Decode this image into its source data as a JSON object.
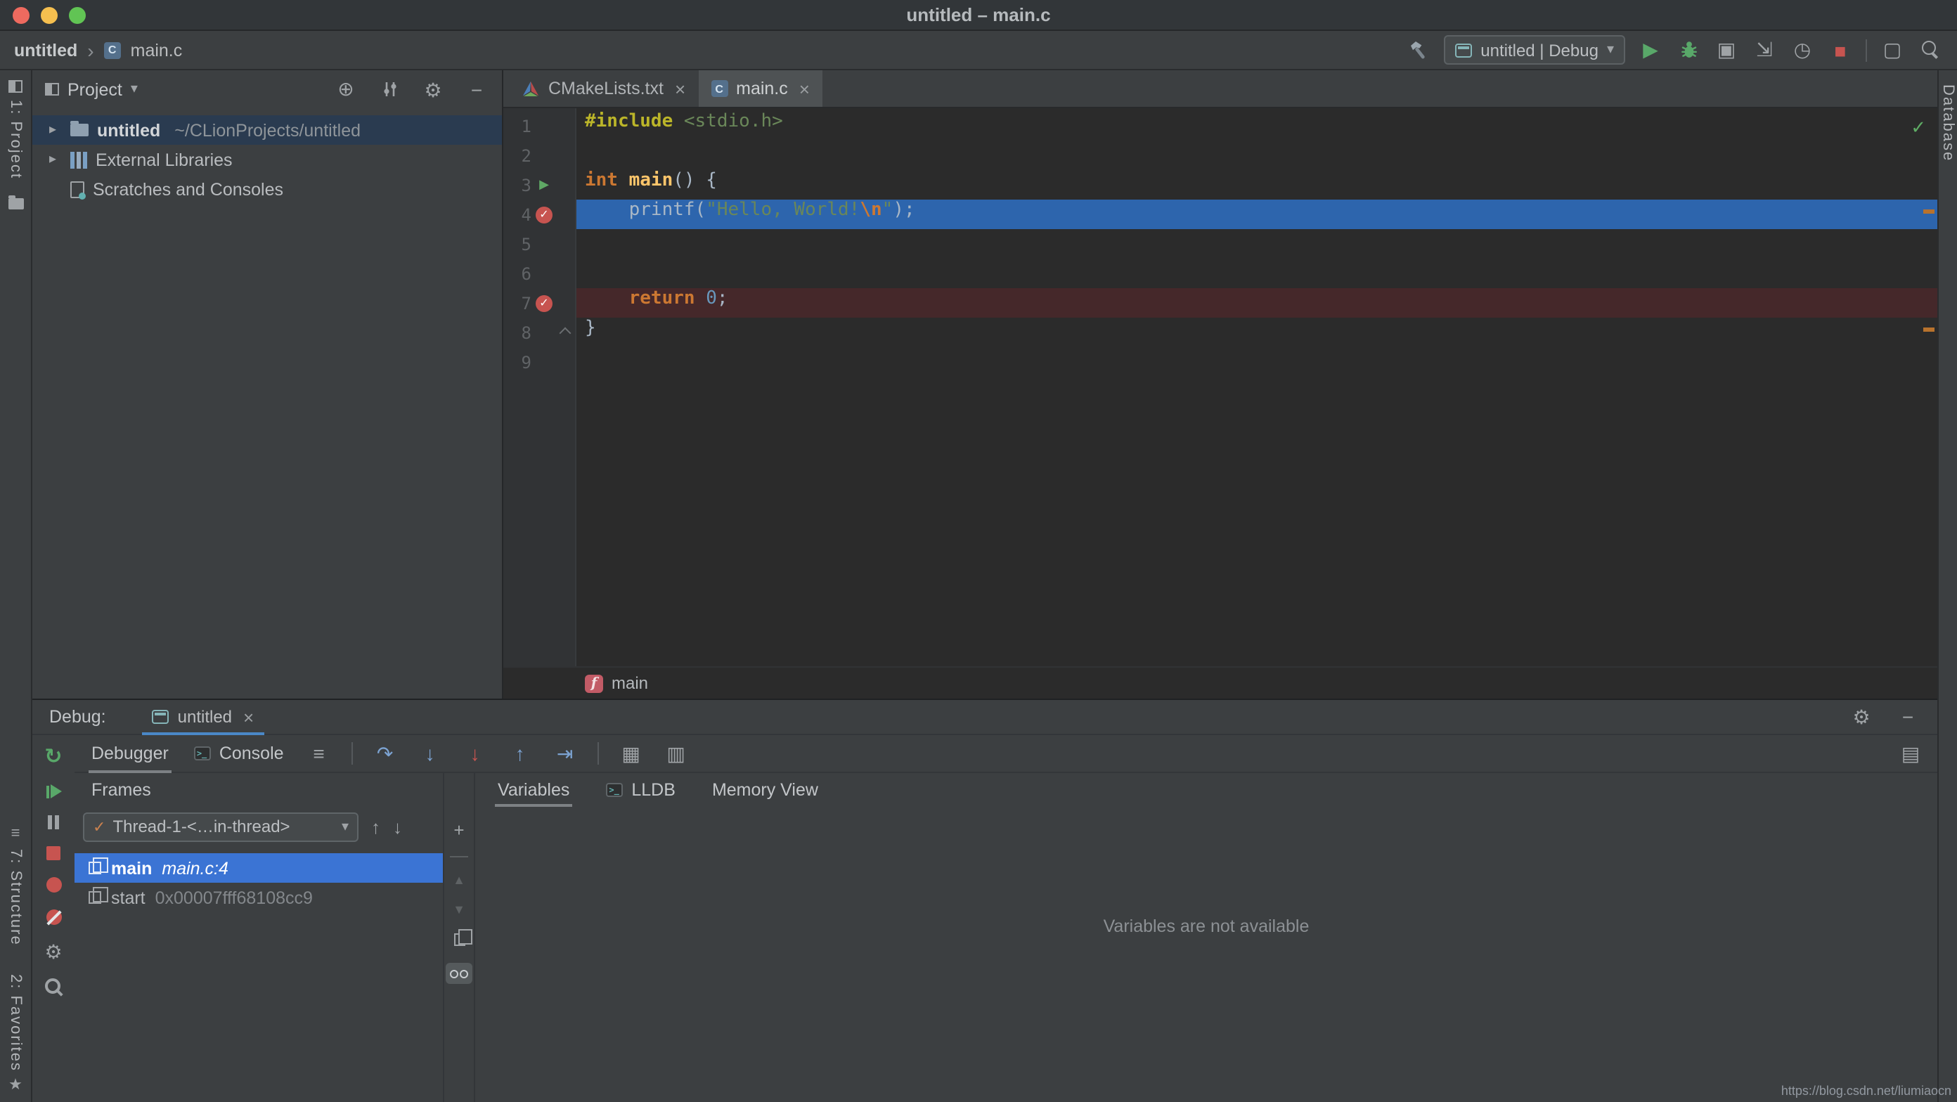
{
  "colors": {
    "execution_line_blue": "#2d65ad",
    "breakpoint_line_red": "#45282a",
    "breakpoint_red": "#c75450",
    "run_green": "#59a869",
    "frame_selection_blue": "#3b74d4",
    "tree_selection_blue": "#2a3b50",
    "session_tab_underline": "#4a88c7",
    "editor_background": "#2b2b2b",
    "panel_background": "#3c3f41"
  },
  "icons": {
    "breadcrumb_chevron": "›",
    "caret_down": "▾",
    "tree_chevron": "▸",
    "run": "▶",
    "stop": "■",
    "rerun": "↻",
    "gear": "⚙",
    "hide": "−",
    "close": "×",
    "locate": "⊕",
    "coverage": "▣",
    "attach": "⇲",
    "profiler": "◷",
    "window_layout": "▢",
    "hamburger": "≡",
    "step_over": "↷",
    "step_into": "↓",
    "force_step_into": "↓",
    "step_out": "↑",
    "run_to_cursor": "⇥",
    "evaluate": "▦",
    "grid": "▥",
    "columns": "▤",
    "arrow_up": "↑",
    "arrow_down": "↓",
    "add": "+",
    "move_up": "▲",
    "move_down": "▼",
    "check": "✓",
    "star": "★",
    "c_letter": "C",
    "terminal": ">_"
  },
  "titlebar": {
    "title": "untitled – main.c"
  },
  "toolbar": {
    "project_crumb": "untitled",
    "file_crumb": "main.c",
    "run_config_label": "untitled | Debug"
  },
  "stripes": {
    "project": "1: Project",
    "structure": "7: Structure",
    "favorites": "2: Favorites",
    "database": "Database"
  },
  "project_panel": {
    "title": "Project",
    "tree": [
      {
        "name": "untitled",
        "path": "~/CLionProjects/untitled"
      },
      {
        "name": "External Libraries"
      },
      {
        "name": "Scratches and Consoles"
      }
    ]
  },
  "editor": {
    "tabs": [
      {
        "label": "CMakeLists.txt"
      },
      {
        "label": "main.c"
      }
    ],
    "lines": [
      {
        "num": "1",
        "tokens": [
          {
            "t": "#include"
          },
          {
            "t": " "
          },
          {
            "t": "<stdio.h>"
          }
        ]
      },
      {
        "num": "2"
      },
      {
        "num": "3",
        "tokens": [
          {
            "t": "int"
          },
          {
            "t": " "
          },
          {
            "t": "main"
          },
          {
            "t": "() {"
          }
        ]
      },
      {
        "num": "4",
        "tokens": [
          {
            "t": "    printf("
          },
          {
            "t": "\"Hello, World!"
          },
          {
            "t": "\\n"
          },
          {
            "t": "\""
          },
          {
            "t": ");"
          }
        ]
      },
      {
        "num": "5"
      },
      {
        "num": "6"
      },
      {
        "num": "7",
        "tokens": [
          {
            "t": "    "
          },
          {
            "t": "return"
          },
          {
            "t": " "
          },
          {
            "t": "0"
          },
          {
            "t": ";"
          }
        ]
      },
      {
        "num": "8",
        "tokens": [
          {
            "t": "}"
          }
        ]
      },
      {
        "num": "9"
      }
    ],
    "breadcrumb": {
      "icon_letter": "f",
      "function": "main"
    }
  },
  "debug": {
    "title": "Debug:",
    "session_tab": "untitled",
    "tabs": {
      "debugger": "Debugger",
      "console": "Console"
    },
    "frames": {
      "title": "Frames",
      "thread": "Thread-1-<…in-thread>",
      "items": [
        {
          "name": "main",
          "location": "main.c:4"
        },
        {
          "name": "start",
          "location": "0x00007fff68108cc9"
        }
      ]
    },
    "variables": {
      "tabs": {
        "variables": "Variables",
        "lldb": "LLDB",
        "memory": "Memory View"
      },
      "empty_message": "Variables are not available"
    }
  },
  "watermark": "https://blog.csdn.net/liumiaocn"
}
